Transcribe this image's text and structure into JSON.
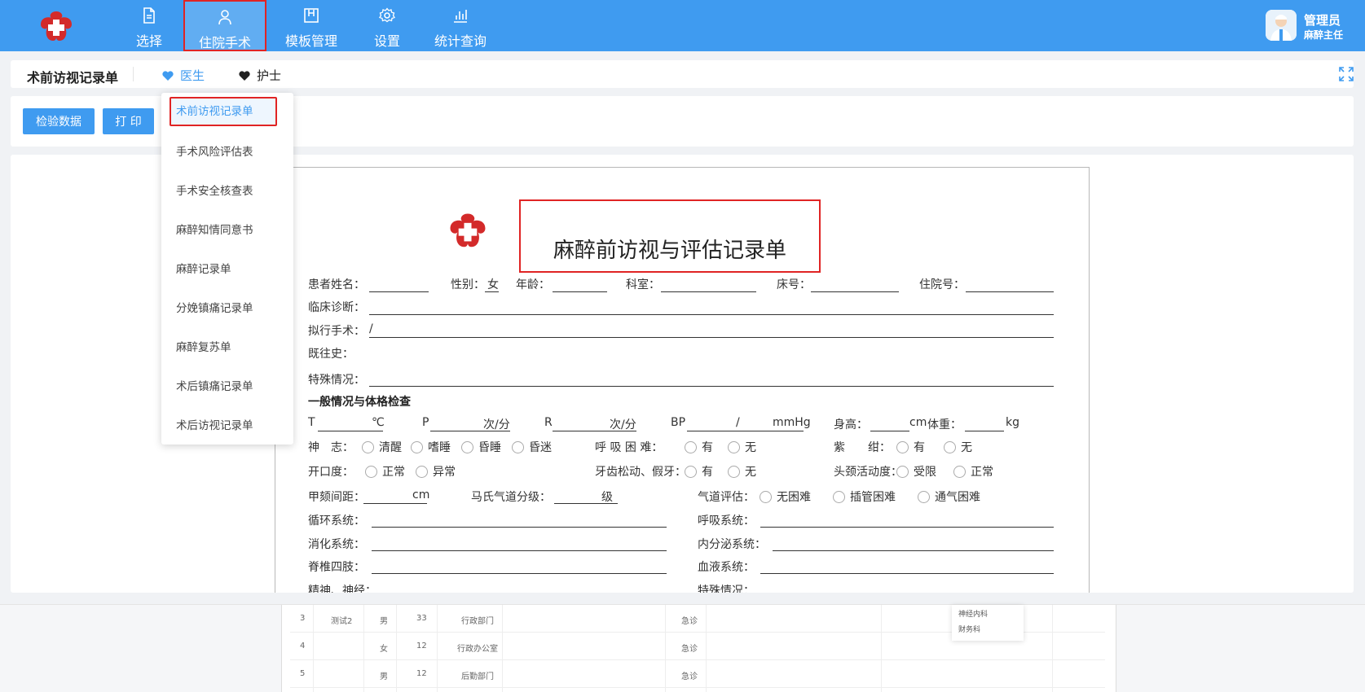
{
  "nav": {
    "items": [
      {
        "label": "选择",
        "icon": "document-icon"
      },
      {
        "label": "住院手术",
        "icon": "user-icon",
        "active": true
      },
      {
        "label": "模板管理",
        "icon": "template-icon"
      },
      {
        "label": "设置",
        "icon": "gear-icon"
      },
      {
        "label": "统计查询",
        "icon": "bar-chart-icon"
      }
    ],
    "user_name": "管理员",
    "user_role": "麻醉主任"
  },
  "tabbar": {
    "title": "术前访视记录单",
    "tab_doctor": "医生",
    "tab_nurse": "护士"
  },
  "toolbar": {
    "check_data": "检验数据",
    "print": "打 印"
  },
  "dropdown": {
    "items": [
      "术前访视记录单",
      "手术风险评估表",
      "手术安全核查表",
      "麻醉知情同意书",
      "麻醉记录单",
      "分娩镇痛记录单",
      "麻醉复苏单",
      "术后镇痛记录单",
      "术后访视记录单"
    ]
  },
  "doc": {
    "title": "麻醉前访视与评估记录单",
    "patient_name": "患者姓名：",
    "gender_label": "性别：",
    "gender_value": "女",
    "age": "年龄：",
    "dept": "科室：",
    "bed": "床号：",
    "admission_no": "住院号：",
    "diagnosis": "临床诊断：",
    "surgery": "拟行手术：",
    "surgery_value": "/",
    "history": "既往史：",
    "special": "特殊情况：",
    "section_general": "一般情况与体格检查",
    "t_label": "T",
    "t_unit": "℃",
    "p_label": "P",
    "p_unit": "次/分",
    "r_label": "R",
    "r_unit": "次/分",
    "bp_label": "BP",
    "bp_sep": "/",
    "bp_unit": "mmHg",
    "height_label": "身高：",
    "height_unit": "cm",
    "weight_label": "体重：",
    "weight_unit": "kg",
    "consciousness": "神　志：",
    "c_opts": [
      "清醒",
      "嗜睡",
      "昏睡",
      "昏迷"
    ],
    "dyspnea": "呼 吸 困 难：",
    "yes": "有",
    "no": "无",
    "cyanosis": "紫　　绀：",
    "mouth_opening": "开口度：",
    "normal": "正常",
    "abnormal": "异常",
    "teeth": "牙齿松动、假牙：",
    "neck": "头颈活动度：",
    "limited": "受限",
    "thyromental": "甲颏间距：",
    "thyro_unit": "cm",
    "mallampati": "马氏气道分级：",
    "mallampati_unit": "级",
    "airway": "气道评估：",
    "airway_opts": [
      "无困难",
      "插管困难",
      "通气困难"
    ],
    "circulation": "循环系统：",
    "respiratory": "呼吸系统：",
    "digestive": "消化系统：",
    "endocrine": "内分泌系统：",
    "spine": "脊椎四肢：",
    "blood": "血液系统：",
    "mental": "精神、神经：",
    "special2": "特殊情况："
  },
  "bottom": {
    "rows": [
      {
        "no": "3",
        "name": "测试2",
        "sex": "男",
        "age": "33",
        "dept": "行政部门",
        "type": "急诊"
      },
      {
        "no": "4",
        "name": "",
        "sex": "女",
        "age": "12",
        "dept": "行政办公室",
        "type": "急诊"
      },
      {
        "no": "5",
        "name": "",
        "sex": "男",
        "age": "12",
        "dept": "后勤部门",
        "type": "急诊"
      }
    ],
    "popup": [
      "神经内科",
      "财务科"
    ]
  },
  "colors": {
    "primary": "#3f9bf0",
    "highlight": "#e02424"
  }
}
